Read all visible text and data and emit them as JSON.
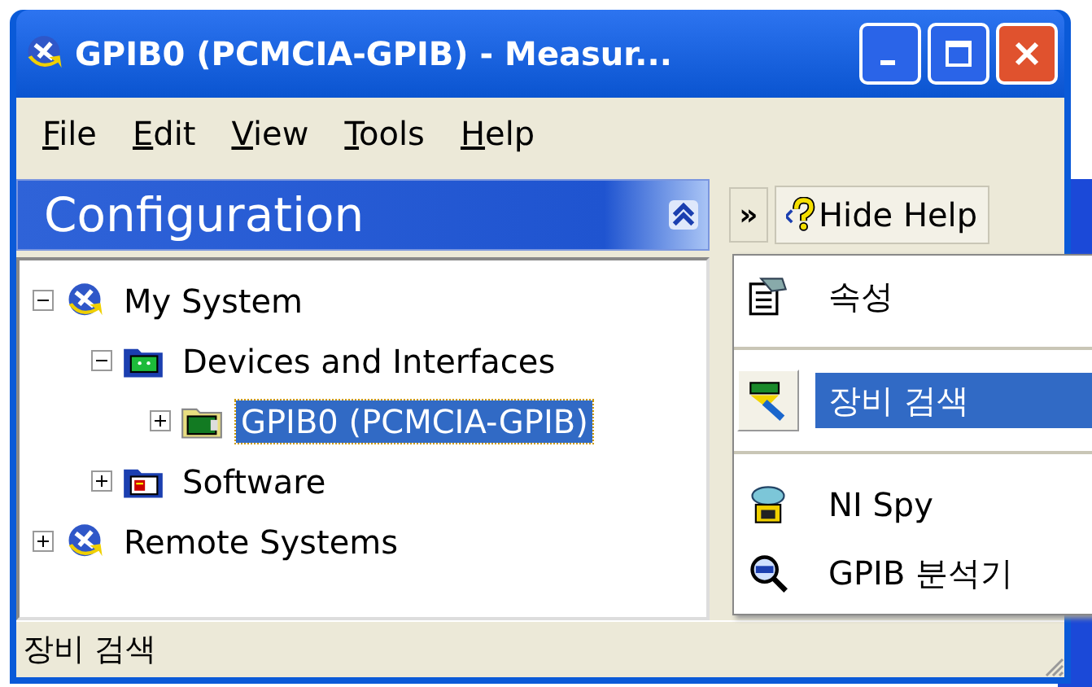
{
  "window": {
    "title": "GPIB0 (PCMCIA-GPIB) - Measur..."
  },
  "menu_bar": [
    {
      "label": "File"
    },
    {
      "label": "Edit"
    },
    {
      "label": "View"
    },
    {
      "label": "Tools"
    },
    {
      "label": "Help"
    }
  ],
  "configuration": {
    "title": "Configuration"
  },
  "tree": [
    {
      "label": "My System",
      "kind": "system",
      "expanded": true,
      "selected": false,
      "children": [
        {
          "label": "Devices and Interfaces",
          "kind": "devices",
          "expanded": true,
          "selected": false,
          "children": [
            {
              "label": "GPIB0 (PCMCIA-GPIB)",
              "kind": "card",
              "expanded": false,
              "selected": true
            }
          ]
        },
        {
          "label": "Software",
          "kind": "software",
          "expanded": false,
          "selected": false
        }
      ]
    },
    {
      "label": "Remote Systems",
      "kind": "system",
      "expanded": false,
      "selected": false
    }
  ],
  "help_toolbar": {
    "chevron": "»",
    "hide_help": "Hide Help"
  },
  "context_menu": [
    {
      "kind": "properties",
      "label": "속성",
      "selected": false
    },
    {
      "kind": "separator"
    },
    {
      "kind": "scan",
      "label": "장비 검색",
      "selected": true
    },
    {
      "kind": "separator"
    },
    {
      "kind": "spy",
      "label": "NI Spy",
      "selected": false
    },
    {
      "kind": "analyzer",
      "label": "GPIB 분석기",
      "selected": false
    }
  ],
  "status_bar": {
    "text": "장비 검색"
  }
}
